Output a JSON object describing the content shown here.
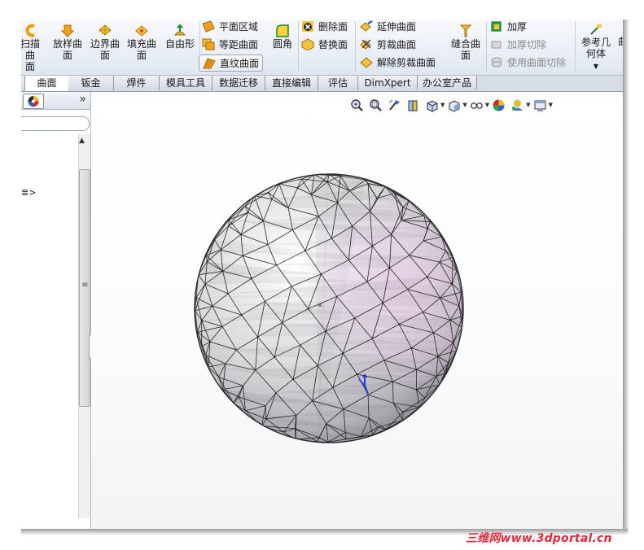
{
  "ribbon": {
    "sweep_surface": {
      "line1": "扫描曲",
      "line2": "面"
    },
    "loft_surface": {
      "line1": "放样曲",
      "line2": "面"
    },
    "boundary_surface": {
      "line1": "边界曲",
      "line2": "面"
    },
    "fill_surface": {
      "line1": "填充曲",
      "line2": "面"
    },
    "freeform": "自由形",
    "planar_surface": "平面区域",
    "offset_surface": "等距曲面",
    "ruled_surface": "直纹曲面",
    "fillet": "圆角",
    "delete_face": "删除面",
    "replace_face": "替换面",
    "extend_surface": "延伸曲面",
    "trim_surface": "剪裁曲面",
    "untrim_surface": "解除剪裁曲面",
    "knit_surface": {
      "line1": "缝合曲",
      "line2": "面"
    },
    "thicken": "加厚",
    "thicken_cut": "加厚切除",
    "cut_with_surface": "使用曲面切除",
    "reference_geometry": {
      "line1": "参考几",
      "line2": "何体"
    },
    "extra_label": "曲"
  },
  "tabs": [
    "曲面",
    "钣金",
    "焊件",
    "模具工具",
    "数据迁移",
    "直接编辑",
    "评估",
    "DimXpert",
    "办公室产品"
  ],
  "active_tab": "曲面",
  "left_pane": {
    "collapse_label": "»",
    "tree_fragment": "≣>"
  },
  "icons": {
    "zoom_to_fit": "zoom-to-fit-icon",
    "zoom_area": "zoom-area-icon",
    "previous_view": "previous-view-icon",
    "section_view": "section-view-icon",
    "view_orientation": "view-orientation-icon",
    "display_style": "display-style-icon",
    "hide_show_items": "hide-show-items-icon",
    "edit_appearance": "edit-appearance-icon",
    "apply_scene": "apply-scene-icon",
    "view_settings": "view-settings-icon"
  },
  "colors": {
    "triad_blue": "#1f3fd6",
    "watermark_red": "#e6273b",
    "tab_active_bg": "#ffffff"
  },
  "watermark": "三维网www.3dportal.cn"
}
